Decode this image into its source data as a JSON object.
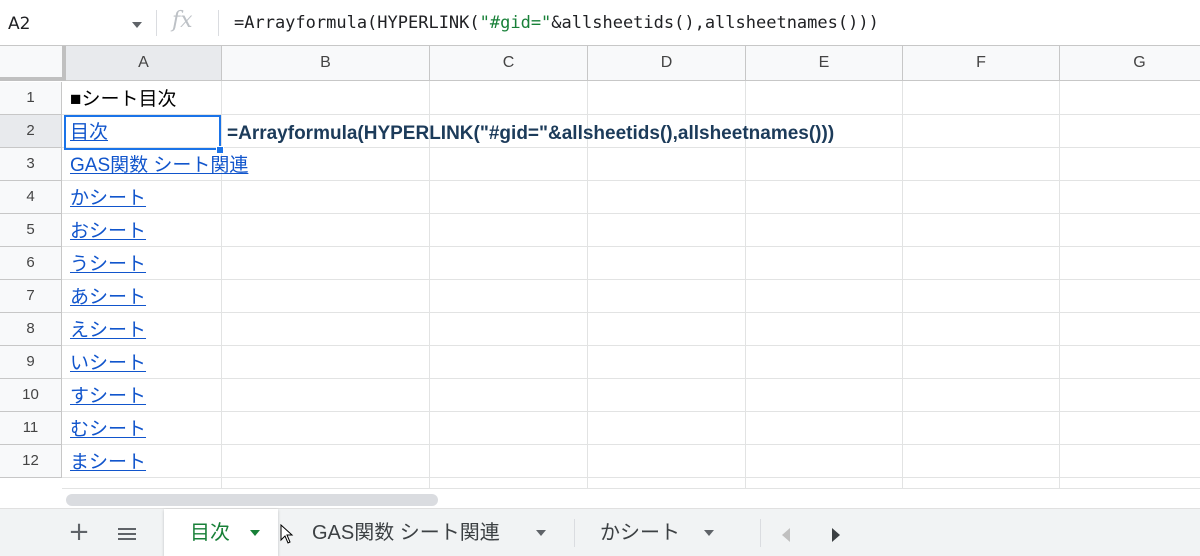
{
  "formula_bar": {
    "cell_ref": "A2",
    "fx_icon": "fx-icon",
    "formula_pre": "=Arrayformula(HYPERLINK(",
    "formula_str": "\"#gid=\"",
    "formula_post": "&allsheetids(),allsheetnames()))"
  },
  "columns": [
    "A",
    "B",
    "C",
    "D",
    "E",
    "F",
    "G"
  ],
  "rows": [
    "1",
    "2",
    "3",
    "4",
    "5",
    "6",
    "7",
    "8",
    "9",
    "10",
    "11",
    "12"
  ],
  "cells": {
    "a1": "■シート目次",
    "a2": "目次",
    "b2_overflow": "=Arrayformula(HYPERLINK(\"#gid=\"&allsheetids(),allsheetnames()))",
    "a3": "GAS関数 シート関連",
    "a4": "かシート",
    "a5": "おシート",
    "a6": "うシート",
    "a7": "あシート",
    "a8": "えシート",
    "a9": "いシート",
    "a10": "すシート",
    "a11": "むシート",
    "a12": "まシート"
  },
  "sheet_tabs": [
    {
      "label": "目次",
      "active": true
    },
    {
      "label": "GAS関数 シート関連",
      "active": false
    },
    {
      "label": "かシート",
      "active": false
    }
  ],
  "colors": {
    "link": "#1155cc",
    "selection": "#1a73e8",
    "active_tab": "#188038"
  }
}
